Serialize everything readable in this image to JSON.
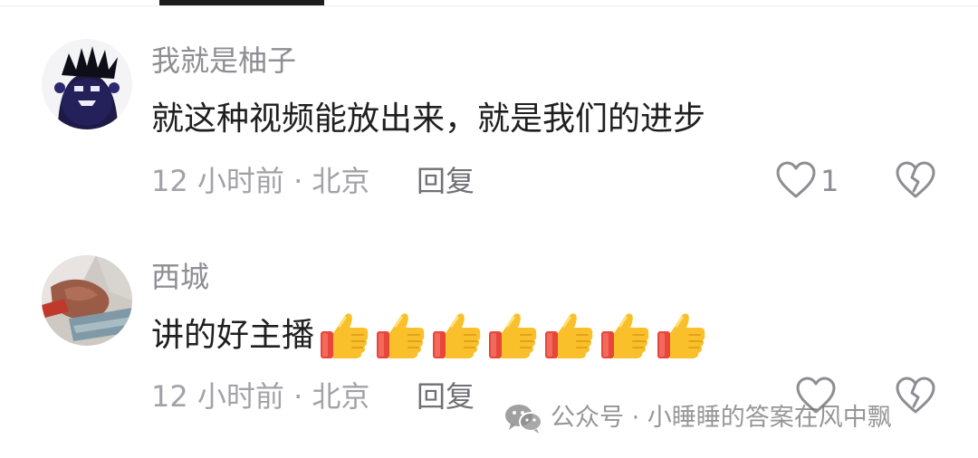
{
  "comments": [
    {
      "username": "我就是柚子",
      "text": "就这种视频能放出来，就是我们的进步",
      "meta": "12 小时前 · 北京",
      "reply_label": "回复",
      "like_count": "1",
      "avatar": "dark-creature-avatar"
    },
    {
      "username": "西城",
      "text": "讲的好主播",
      "emoji_count": 7,
      "emoji": "thumbs-up",
      "meta": "12 小时前 · 北京",
      "reply_label": "回复",
      "like_count": "",
      "avatar": "photo-avatar"
    }
  ],
  "watermark": {
    "text": "公众号 · 小睡睡的答案在风中飘",
    "icon": "wechat-icon"
  },
  "colors": {
    "text_primary": "#1f1f1f",
    "text_secondary": "#8d8d93",
    "meta": "#a2a2a8",
    "tab_indicator": "#1d1d1f"
  }
}
